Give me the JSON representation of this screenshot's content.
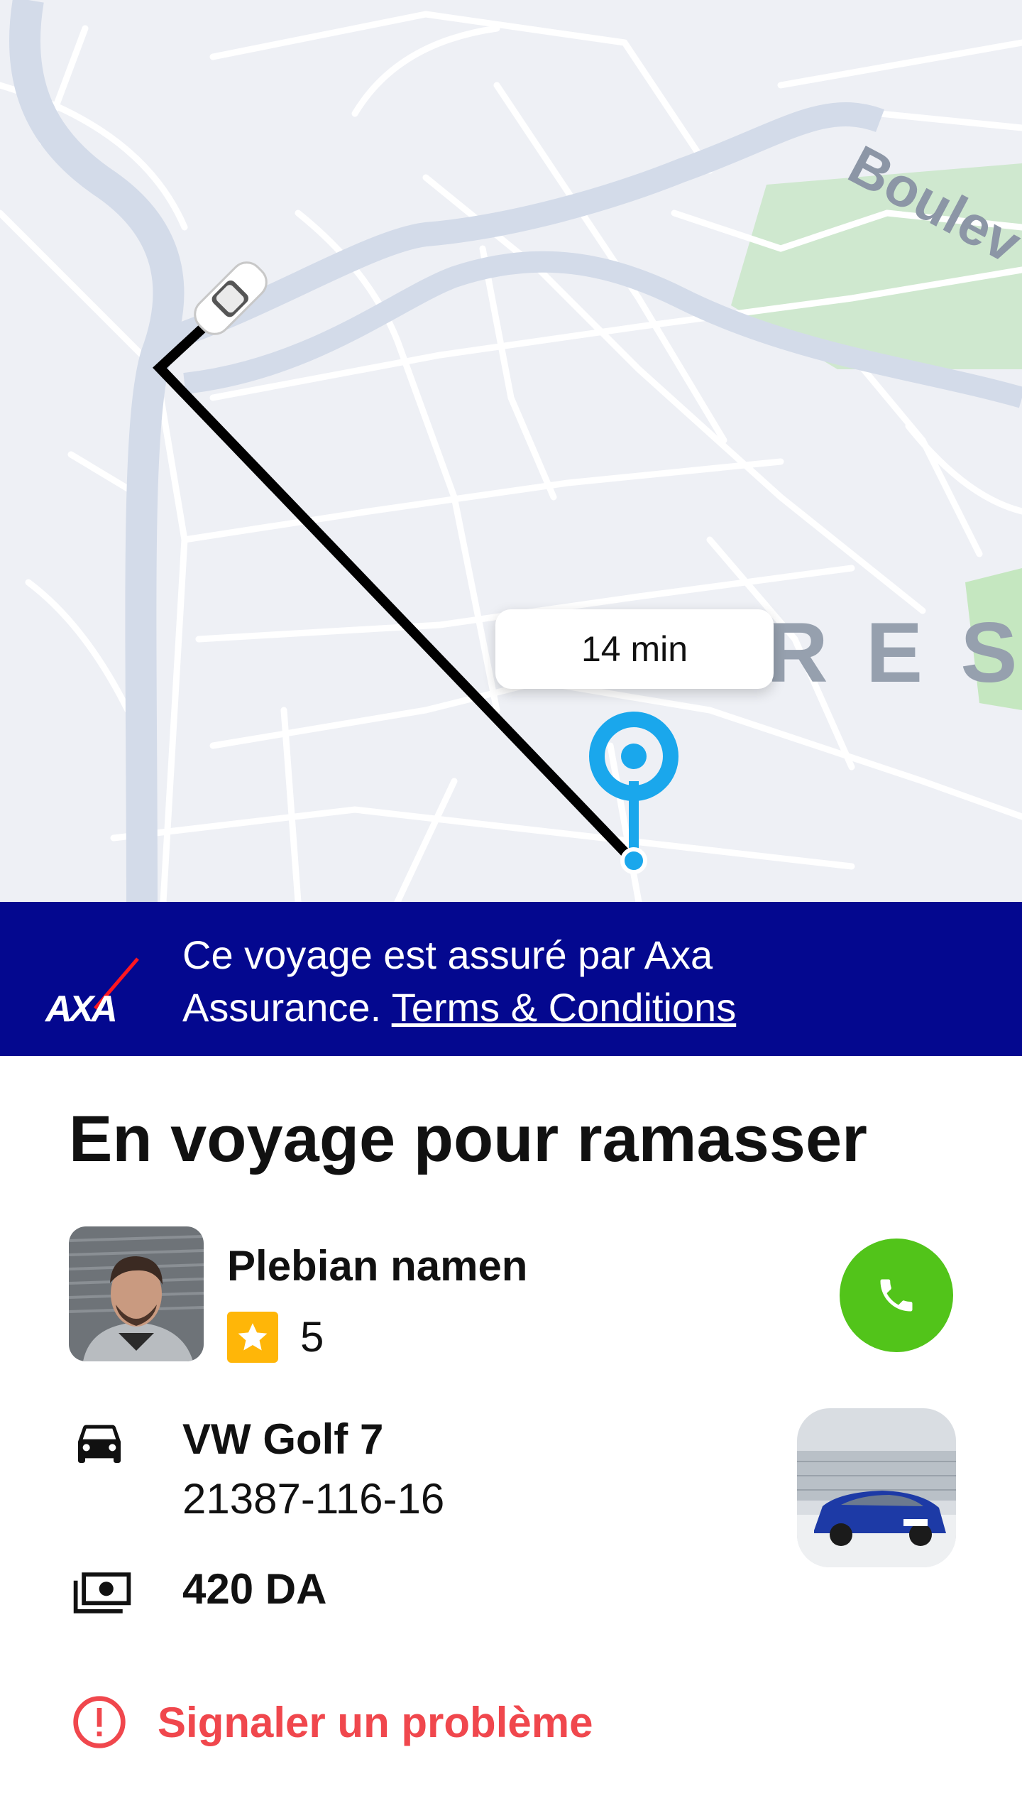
{
  "map": {
    "street_label": "Boulev",
    "district_label": "R E S S",
    "eta": "14 min"
  },
  "banner": {
    "logo_text": "AXA",
    "line1": "Ce voyage est assuré par Axa",
    "line2_prefix": "Assurance.",
    "terms_link": "Terms & Conditions"
  },
  "trip": {
    "status_title": "En voyage pour ramasser"
  },
  "driver": {
    "name": "Plebian namen",
    "rating": "5"
  },
  "vehicle": {
    "model": "VW Golf 7",
    "plate": "21387-116-16"
  },
  "fare": {
    "amount": "420 DA"
  },
  "actions": {
    "report_label": "Signaler un problème"
  },
  "colors": {
    "banner_bg": "#04088f",
    "call_button": "#52c41a",
    "pin": "#1aa7ec",
    "report": "#f0474d",
    "star": "#ffb608"
  },
  "icons": [
    "car-marker-icon",
    "destination-pin-icon",
    "axa-logo",
    "star-icon",
    "phone-icon",
    "car-icon",
    "money-icon",
    "alert-icon"
  ]
}
